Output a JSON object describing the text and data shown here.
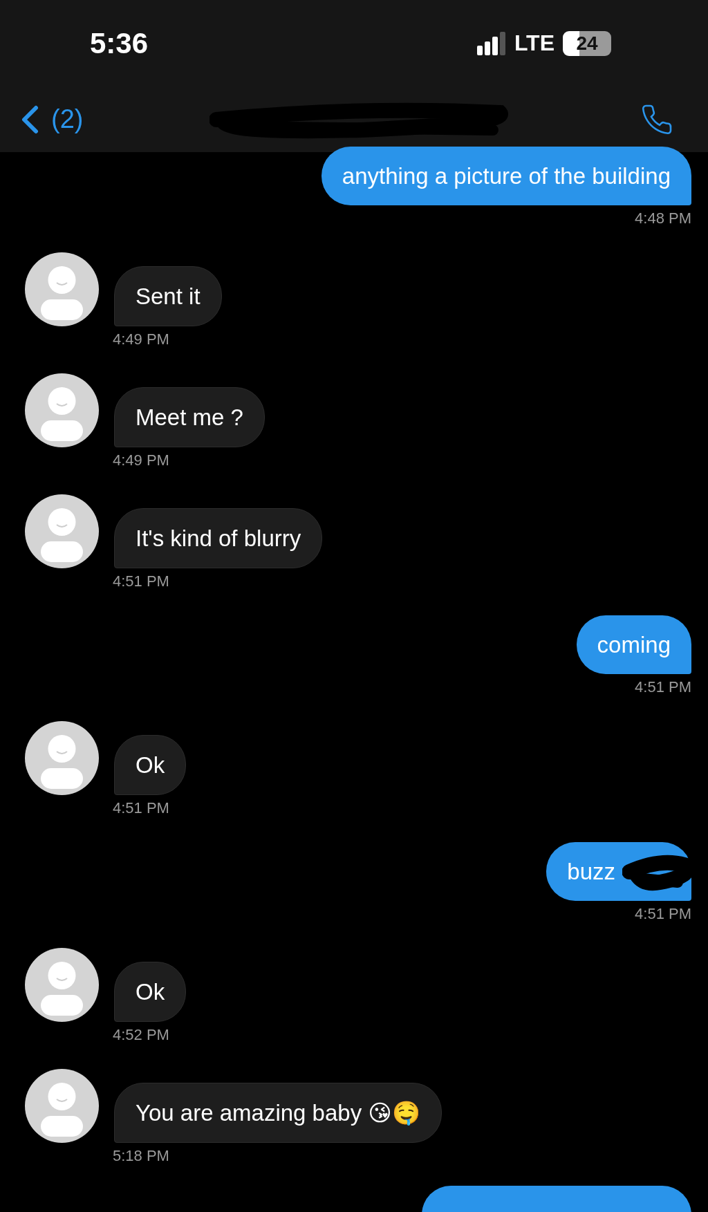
{
  "status_bar": {
    "time": "5:36",
    "network": "LTE",
    "battery": "24"
  },
  "nav": {
    "back_count": "(2)",
    "title_redacted": true
  },
  "messages": [
    {
      "kind": "outgoing",
      "text": "anything a picture of the building",
      "time": "4:48 PM"
    },
    {
      "kind": "incoming",
      "text": "Sent it",
      "time": "4:49 PM"
    },
    {
      "kind": "incoming",
      "text": "Meet me ?",
      "time": "4:49 PM"
    },
    {
      "kind": "incoming",
      "text": "It's kind of blurry",
      "time": "4:51 PM"
    },
    {
      "kind": "outgoing",
      "text": "coming",
      "time": "4:51 PM"
    },
    {
      "kind": "incoming",
      "text": "Ok",
      "time": "4:51 PM"
    },
    {
      "kind": "outgoing",
      "text": "buzz",
      "time": "4:51 PM",
      "redacted": true
    },
    {
      "kind": "incoming",
      "text": "Ok",
      "time": "4:52 PM"
    },
    {
      "kind": "incoming",
      "text": "You are amazing baby 😘🤤",
      "time": "5:18 PM"
    },
    {
      "kind": "outgoing_cut"
    }
  ]
}
